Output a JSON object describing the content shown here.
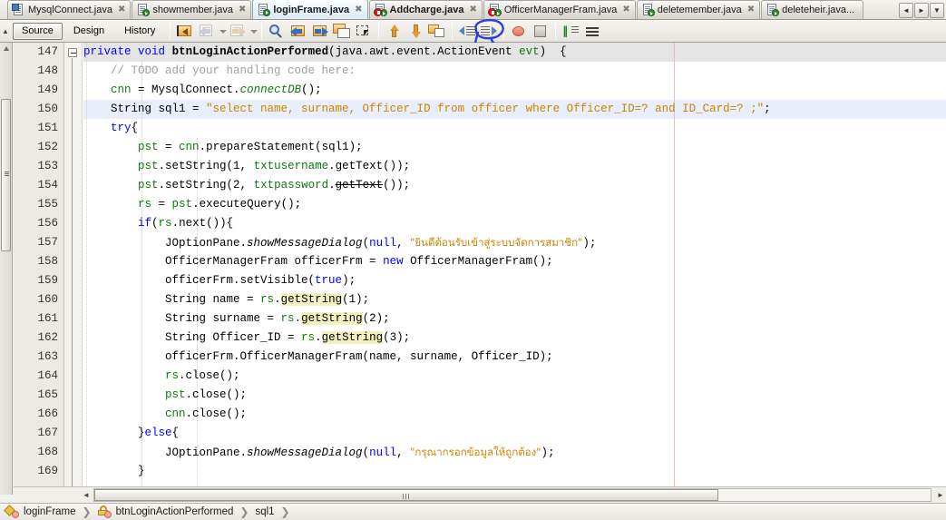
{
  "window": {
    "title": "NetBeans IDE - loginFrame.java"
  },
  "tabs": [
    {
      "label": "MysqlConnect.java",
      "icon": "java-file-icon",
      "active": false,
      "badge": "none",
      "closable": true
    },
    {
      "label": "showmember.java",
      "icon": "java-file-icon",
      "active": false,
      "badge": "green",
      "closable": true
    },
    {
      "label": "loginFrame.java",
      "icon": "java-file-icon",
      "active": true,
      "badge": "green",
      "closable": true
    },
    {
      "label": "Addcharge.java",
      "icon": "java-file-icon",
      "active": false,
      "badge": "red",
      "closable": true
    },
    {
      "label": "OfficerManagerFram.java",
      "icon": "java-file-icon",
      "active": false,
      "badge": "red",
      "closable": true
    },
    {
      "label": "deletemember.java",
      "icon": "java-file-icon",
      "active": false,
      "badge": "green",
      "closable": true
    },
    {
      "label": "deleteheir.java...",
      "icon": "java-file-icon",
      "active": false,
      "badge": "green",
      "closable": false
    }
  ],
  "tab_nav": {
    "prev": "◄",
    "next": "►",
    "list": "▼"
  },
  "toolbar": {
    "views": [
      {
        "label": "Source",
        "selected": true
      },
      {
        "label": "Design",
        "selected": false
      },
      {
        "label": "History",
        "selected": false
      }
    ],
    "buttons": [
      {
        "name": "last-edit-position-icon",
        "enabled": true
      },
      {
        "name": "back-icon",
        "enabled": false
      },
      {
        "name": "back-dropdown-icon",
        "enabled": false
      },
      {
        "name": "forward-icon",
        "enabled": false
      },
      {
        "name": "forward-dropdown-icon",
        "enabled": false
      },
      {
        "name": "find-selection-icon",
        "enabled": true
      },
      {
        "name": "find-previous-icon",
        "enabled": true
      },
      {
        "name": "find-next-icon",
        "enabled": true
      },
      {
        "name": "toggle-highlight-icon",
        "enabled": true
      },
      {
        "name": "toggle-rectangular-selection-icon",
        "enabled": true
      },
      {
        "name": "previous-bookmark-icon",
        "enabled": true
      },
      {
        "name": "next-bookmark-icon",
        "enabled": true
      },
      {
        "name": "toggle-bookmark-icon",
        "enabled": true
      },
      {
        "name": "shift-left-icon",
        "enabled": true
      },
      {
        "name": "shift-right-icon",
        "enabled": true
      },
      {
        "name": "toggle-breakpoint-icon",
        "enabled": true
      },
      {
        "name": "stop-icon",
        "enabled": true
      },
      {
        "name": "comment-icon",
        "enabled": true
      },
      {
        "name": "uncomment-icon",
        "enabled": true
      }
    ]
  },
  "annotation": {
    "type": "hand-drawn-blue-ellipse-with-pointer",
    "color": "#2a3fd8",
    "targets": "toggle-breakpoint-icon"
  },
  "editor": {
    "first_line": 147,
    "current_line": 150,
    "caret_line": 150,
    "highlighted_rows": {
      "grey": 147,
      "blue": 150
    },
    "right_margin_column": 80,
    "lines": [
      {
        "n": 147,
        "text": "private void btnLoginActionPerformed(java.awt.event.ActionEvent evt) {"
      },
      {
        "n": 148,
        "text": "    // TODO add your handling code here:"
      },
      {
        "n": 149,
        "text": "    cnn = MysqlConnect.connectDB();"
      },
      {
        "n": 150,
        "text": "    String sql1 = \"select name, surname, Officer_ID from officer where Officer_ID=? and ID_Card=? ;\";"
      },
      {
        "n": 151,
        "text": "    try{"
      },
      {
        "n": 152,
        "text": "        pst = cnn.prepareStatement(sql1);"
      },
      {
        "n": 153,
        "text": "        pst.setString(1, txtusername.getText());"
      },
      {
        "n": 154,
        "text": "        pst.setString(2, txtpassword.getText());"
      },
      {
        "n": 155,
        "text": "        rs = pst.executeQuery();"
      },
      {
        "n": 156,
        "text": "        if(rs.next()){"
      },
      {
        "n": 157,
        "text": "            JOptionPane.showMessageDialog(null, \"ยินดีต้อนรับเข้าสู่ระบบจัดการสมาชิก\");"
      },
      {
        "n": 158,
        "text": "            OfficerManagerFram officerFrm = new OfficerManagerFram();"
      },
      {
        "n": 159,
        "text": "            officerFrm.setVisible(true);"
      },
      {
        "n": 160,
        "text": "            String name = rs.getString(1);"
      },
      {
        "n": 161,
        "text": "            String surname = rs.getString(2);"
      },
      {
        "n": 162,
        "text": "            String Officer_ID = rs.getString(3);"
      },
      {
        "n": 163,
        "text": "            officerFrm.OfficerManagerFram(name, surname, Officer_ID);"
      },
      {
        "n": 164,
        "text": "            rs.close();"
      },
      {
        "n": 165,
        "text": "            pst.close();"
      },
      {
        "n": 166,
        "text": "            cnn.close();"
      },
      {
        "n": 167,
        "text": "        }else{"
      },
      {
        "n": 168,
        "text": "            JOptionPane.showMessageDialog(null, \"กรุณากรอกข้อมูลให้ถูกต้อง\");"
      },
      {
        "n": 169,
        "text": "        }"
      }
    ],
    "occurrence_highlight": "getString",
    "deprecated_strikethrough": "getText",
    "thai_strings": [
      "ยินดีต้อนรับเข้าสู่ระบบจัดการสมาชิก",
      "กรุณากรอกข้อมูลให้ถูกต้อง"
    ]
  },
  "breadcrumb": {
    "items": [
      {
        "label": "loginFrame",
        "icon": "class-icon"
      },
      {
        "label": "btnLoginActionPerformed",
        "icon": "method-icon"
      },
      {
        "label": "sql1",
        "icon": "field-icon"
      }
    ],
    "separator": "❯"
  },
  "scrollbars": {
    "horizontal": {
      "arrow_left": "◄",
      "arrow_right": "►",
      "thumb_grip": "‖"
    },
    "vertical_left_present": true
  },
  "colors": {
    "keyword": "#0000ff",
    "string": "#cc8400",
    "comment": "#a0a0a0",
    "field": "#0e7a0e",
    "occurrence_highlight_bg": "#f2f0bf",
    "caret_row_bg": "#e8eefa",
    "method_row_bg": "#e4e4e4",
    "annotation": "#2a3fd8",
    "right_margin": "#f2b9b9"
  }
}
